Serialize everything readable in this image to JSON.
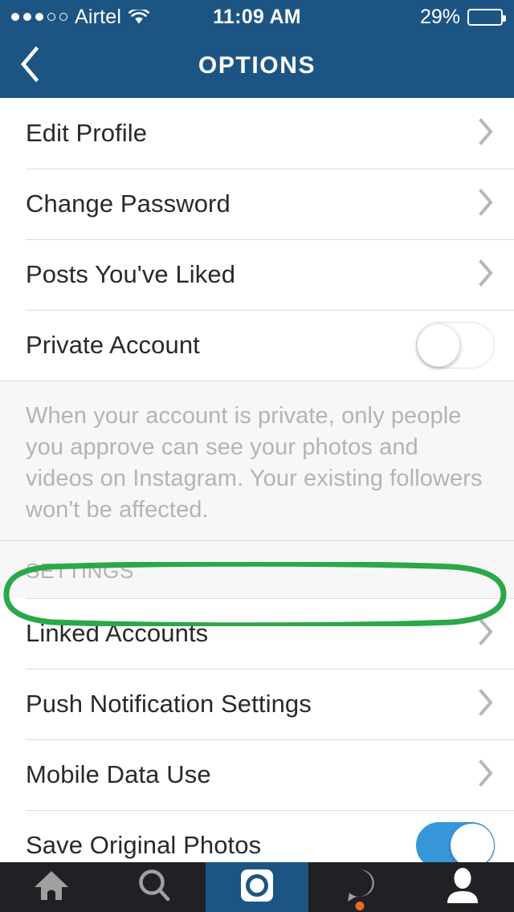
{
  "status_bar": {
    "signal_dots_filled": 3,
    "signal_dots_total": 5,
    "carrier": "Airtel",
    "wifi_icon": "wifi-icon",
    "time": "11:09 AM",
    "battery_percent_label": "29%",
    "battery_level": 29
  },
  "nav": {
    "back_icon": "back-chevron-icon",
    "title": "OPTIONS"
  },
  "list": {
    "items": [
      {
        "label": "Edit Profile",
        "accessory": "chevron"
      },
      {
        "label": "Change Password",
        "accessory": "chevron"
      },
      {
        "label": "Posts You've Liked",
        "accessory": "chevron"
      },
      {
        "label": "Private Account",
        "accessory": "toggle",
        "toggle_on": false
      }
    ],
    "description": "When your account is private, only people you approve can see your photos and videos on Instagram. Your existing followers won't be affected.",
    "section_header": "SETTINGS",
    "settings_items": [
      {
        "label": "Linked Accounts",
        "accessory": "chevron",
        "highlighted": true
      },
      {
        "label": "Push Notification Settings",
        "accessory": "chevron",
        "highlighted": false
      },
      {
        "label": "Mobile Data Use",
        "accessory": "chevron",
        "highlighted": false
      },
      {
        "label": "Save Original Photos",
        "accessory": "toggle",
        "toggle_on": true,
        "highlighted": false
      }
    ]
  },
  "annotation": {
    "shape": "ellipse",
    "color": "#2aa84a",
    "target": "Linked Accounts"
  },
  "tabbar": {
    "tabs": [
      {
        "icon": "home-icon",
        "name": "home",
        "selected": false
      },
      {
        "icon": "search-icon",
        "name": "search",
        "selected": false
      },
      {
        "icon": "camera-icon",
        "name": "camera",
        "selected": true
      },
      {
        "icon": "activity-heart-icon",
        "name": "activity",
        "selected": false,
        "badge": true
      },
      {
        "icon": "profile-icon",
        "name": "profile",
        "selected": false,
        "active_white": true
      }
    ]
  },
  "colors": {
    "navbar_blue": "#1c5583",
    "toggle_on_blue": "#3897d8",
    "annotation_green": "#2aa84a",
    "badge_orange": "#ec6a1f",
    "tabbar_dark": "#1f2124"
  }
}
